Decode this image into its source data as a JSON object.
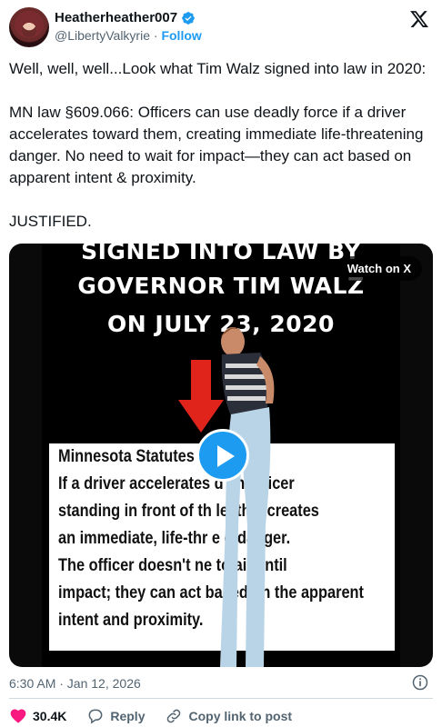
{
  "author": {
    "display_name": "Heatherheather007",
    "handle": "@LibertyValkyrie",
    "separator": "·",
    "follow_label": "Follow"
  },
  "tweet": {
    "line1": "Well, well, well...Look what Tim Walz signed into law in 2020:",
    "line2": "MN law §609.066: Officers can use deadly force if a driver accelerates toward them, creating immediate life-threatening danger. No need to wait for impact—they can act based on apparent intent & proximity.",
    "line3": "JUSTIFIED."
  },
  "media": {
    "watch_label": "Watch on X",
    "headline": [
      "SIGNED INTO LAW BY",
      "GOVERNOR TIM WALZ",
      "ON JULY 23, 2020"
    ],
    "statute_lines": [
      "Minnesota Statutes                 36",
      "If a driver accelerates         d an officer",
      "standing in front of th           le, this creates",
      "an immediate, life-thr       e   g danger.",
      "The officer doesn't ne     to    ait until",
      "impact; they can act based on the apparent",
      "intent and proximity."
    ]
  },
  "timestamp": "6:30 AM · Jan 12, 2026",
  "actions": {
    "likes": "30.4K",
    "reply_label": "Reply",
    "copy_label": "Copy link to post"
  },
  "colors": {
    "accent": "#1d9bf0",
    "like": "#f91880",
    "muted": "#536471"
  },
  "icons": [
    "verified-badge-icon",
    "x-logo-icon",
    "play-icon",
    "info-icon",
    "heart-icon",
    "reply-icon",
    "link-icon"
  ]
}
